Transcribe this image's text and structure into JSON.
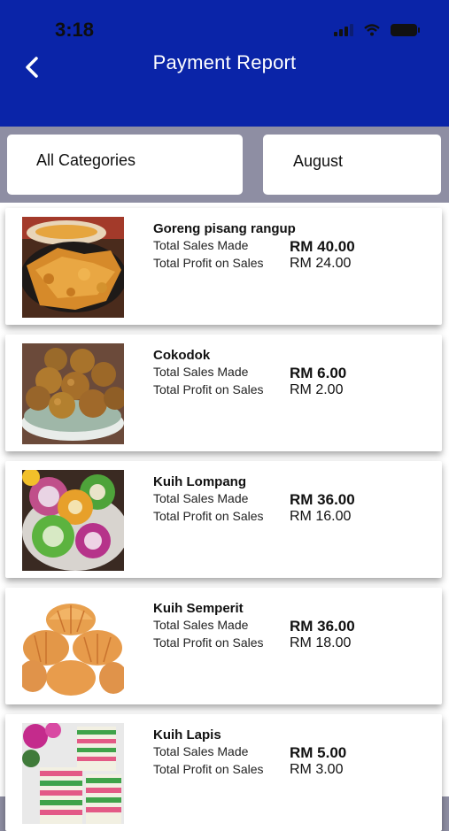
{
  "status": {
    "time": "3:18"
  },
  "header": {
    "title": "Payment Report"
  },
  "filters": {
    "category": "All Categories",
    "month": "August"
  },
  "items": [
    {
      "name": "Goreng pisang rangup",
      "sales_label": "Total Sales Made",
      "sales": "RM 40.00",
      "profit_label": "Total Profit on Sales",
      "profit": "RM 24.00"
    },
    {
      "name": "Cokodok",
      "sales_label": "Total Sales Made",
      "sales": "RM 6.00",
      "profit_label": "Total Profit on Sales",
      "profit": "RM 2.00"
    },
    {
      "name": "Kuih Lompang",
      "sales_label": "Total Sales Made",
      "sales": "RM 36.00",
      "profit_label": "Total Profit on Sales",
      "profit": "RM 16.00"
    },
    {
      "name": "Kuih Semperit",
      "sales_label": "Total Sales Made",
      "sales": "RM 36.00",
      "profit_label": "Total Profit on Sales",
      "profit": "RM 18.00"
    },
    {
      "name": "Kuih Lapis",
      "sales_label": "Total Sales Made",
      "sales": "RM 5.00",
      "profit_label": "Total Profit on Sales",
      "profit": "RM 3.00"
    }
  ],
  "colors": {
    "header": "#0a24a8",
    "backdrop": "#8e8ea3"
  }
}
